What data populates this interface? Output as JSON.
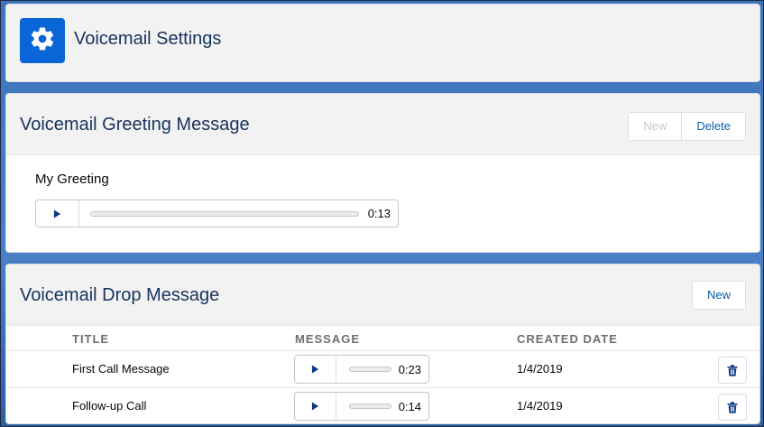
{
  "header": {
    "title": "Voicemail Settings",
    "icon": "gear-icon",
    "icon_bg": "#0a66d6"
  },
  "greeting": {
    "title": "Voicemail Greeting Message",
    "new_label": "New",
    "delete_label": "Delete",
    "item_label": "My Greeting",
    "duration": "0:13"
  },
  "drop": {
    "title": "Voicemail Drop Message",
    "new_label": "New",
    "columns": [
      "TITLE",
      "MESSAGE",
      "CREATED DATE"
    ],
    "rows": [
      {
        "title": "First Call Message",
        "duration": "0:23",
        "created": "1/4/2019"
      },
      {
        "title": "Follow-up Call",
        "duration": "0:14",
        "created": "1/4/2019"
      }
    ]
  }
}
